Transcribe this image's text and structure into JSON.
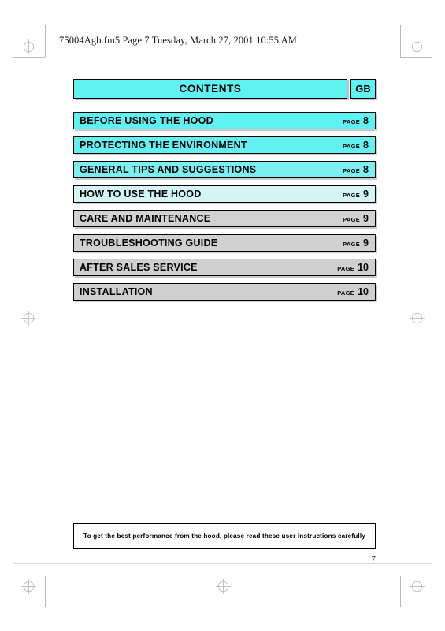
{
  "header": {
    "running_head": "75004Agb.fm5  Page 7  Tuesday, March 27, 2001  10:55 AM"
  },
  "contents": {
    "title": "CONTENTS",
    "language_code": "GB",
    "page_word": "PAGE",
    "entries": [
      {
        "label": "BEFORE USING THE HOOD",
        "page": "8",
        "fill": "#5ff2f2"
      },
      {
        "label": "PROTECTING THE ENVIRONMENT",
        "page": "8",
        "fill": "#63f0f0"
      },
      {
        "label": "GENERAL TIPS AND SUGGESTIONS",
        "page": "8",
        "fill": "#7cf0f0"
      },
      {
        "label": "HOW TO USE THE HOOD",
        "page": "9",
        "fill": "#d5f4f4"
      },
      {
        "label": "CARE AND MAINTENANCE",
        "page": "9",
        "fill": "#d2d2d2"
      },
      {
        "label": "TROUBLESHOOTING GUIDE",
        "page": "9",
        "fill": "#d0d0d0"
      },
      {
        "label": "AFTER SALES SERVICE",
        "page": "10",
        "fill": "#cfcfcf"
      },
      {
        "label": "INSTALLATION",
        "page": "10",
        "fill": "#cfcfcf"
      }
    ]
  },
  "footer": {
    "note": "To get the best performance from the hood, please read these user instructions carefully",
    "folio": "7"
  },
  "colors": {
    "accent_cyan": "#5ff2f2",
    "row_gray": "#d0d0d0",
    "ink": "#000000",
    "registration": "#9a9a9a"
  }
}
